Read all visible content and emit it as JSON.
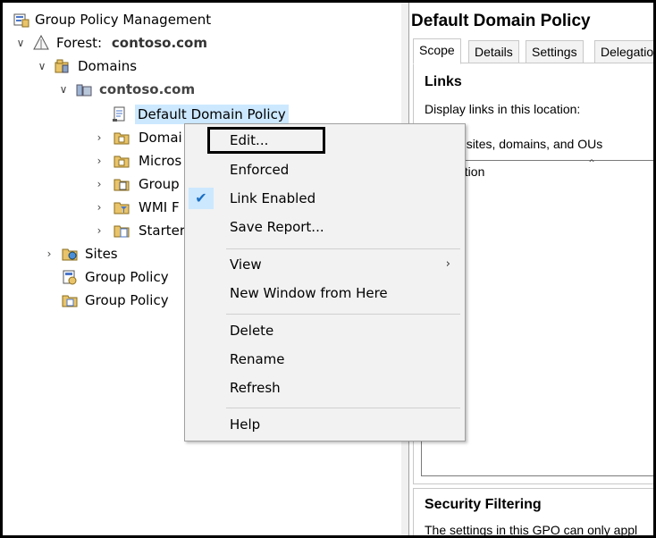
{
  "tree": {
    "root_label": "Group Policy Management",
    "forest_label": "Forest:",
    "forest_name": "contoso.com",
    "domains_label": "Domains",
    "domain_name": "contoso.com",
    "selected_gpo": "Default Domain Policy",
    "children_partial": [
      "Domai",
      "Micros",
      "Group",
      "WMI F",
      "Starter"
    ],
    "sites_label": "Sites",
    "gp_modeling": "Group Policy",
    "gp_results": "Group Policy"
  },
  "right_pane": {
    "title": "Default Domain Policy",
    "tabs": [
      "Scope",
      "Details",
      "Settings",
      "Delegatio"
    ],
    "links_header": "Links",
    "links_text": "Display links in this location:",
    "links_list_text": "llowing sites, domains, and OUs",
    "column_text": "ation",
    "security_header": "Security Filtering",
    "security_text": "The settings in this GPO can only appl"
  },
  "context_menu": {
    "items": [
      {
        "label": "Edit...",
        "highlighted_box": true
      },
      {
        "label": "Enforced"
      },
      {
        "label": "Link Enabled",
        "checked": true
      },
      {
        "label": "Save Report..."
      },
      {
        "label": "View",
        "submenu": true
      },
      {
        "label": "New Window from Here"
      },
      {
        "label": "Delete"
      },
      {
        "label": "Rename"
      },
      {
        "label": "Refresh"
      },
      {
        "label": "Help"
      }
    ]
  },
  "colors": {
    "selection": "#cce8ff",
    "menu_bg": "#f2f2f2",
    "check": "#1a6fc4"
  },
  "icons": {
    "check": "✔",
    "submenu_arrow": "›"
  }
}
